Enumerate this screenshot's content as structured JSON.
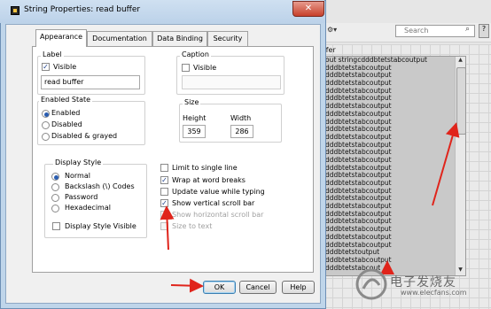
{
  "window": {
    "title": "String Properties: read buffer",
    "close_label": "✕"
  },
  "tabs": [
    {
      "label": "Appearance",
      "active": true
    },
    {
      "label": "Documentation",
      "active": false
    },
    {
      "label": "Data Binding",
      "active": false
    },
    {
      "label": "Security",
      "active": false
    }
  ],
  "label_group": {
    "title": "Label",
    "visible_label": "Visible",
    "visible_checked": true,
    "value": "read buffer"
  },
  "caption_group": {
    "title": "Caption",
    "visible_label": "Visible",
    "visible_checked": false,
    "value": ""
  },
  "enabled_state": {
    "title": "Enabled State",
    "options": [
      "Enabled",
      "Disabled",
      "Disabled & grayed"
    ],
    "selected": "Enabled"
  },
  "size_group": {
    "title": "Size",
    "height_label": "Height",
    "height_value": "359",
    "width_label": "Width",
    "width_value": "286"
  },
  "display_style": {
    "title": "Display Style",
    "options": [
      "Normal",
      "Backslash (\\) Codes",
      "Password",
      "Hexadecimal"
    ],
    "selected": "Normal",
    "visible_label": "Display Style Visible",
    "visible_checked": false
  },
  "options": [
    {
      "label": "Limit to single line",
      "checked": false,
      "enabled": true
    },
    {
      "label": "Wrap at word breaks",
      "checked": true,
      "enabled": true
    },
    {
      "label": "Update value while typing",
      "checked": false,
      "enabled": true
    },
    {
      "label": "Show vertical scroll bar",
      "checked": true,
      "enabled": true
    },
    {
      "label": "Show horizontal scroll bar",
      "checked": false,
      "enabled": false
    },
    {
      "label": "Size to text",
      "checked": false,
      "enabled": false
    }
  ],
  "buttons": {
    "ok": "OK",
    "cancel": "Cancel",
    "help": "Help"
  },
  "background": {
    "search_placeholder": "Search",
    "indicator_label": "ffer",
    "string_first_line": "out stringcdddbtetstabcoutput",
    "string_line": "dddbtetstabcoutput",
    "string_last_line": "dddbtetstoutput",
    "string_bottom_line": "dddbtetstabcout"
  },
  "watermark": {
    "text": "电子发烧友",
    "url": "www.elecfans.com"
  },
  "colors": {
    "arrow": "#e0241b",
    "dialog_frame": "#bfd5ea",
    "string_bg": "#c9c9c9"
  }
}
